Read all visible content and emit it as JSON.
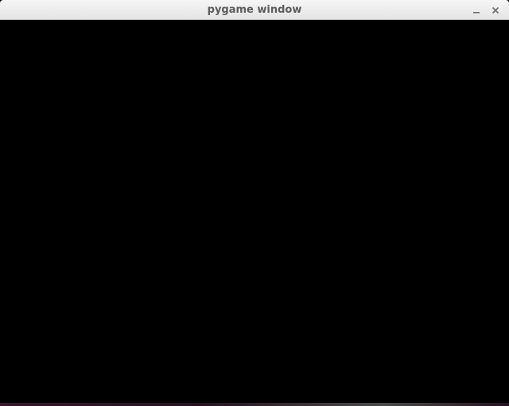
{
  "window": {
    "title": "pygame window",
    "controls": {
      "minimize_icon": "minimize-icon",
      "close_icon": "close-icon"
    },
    "content_background": "#000000"
  }
}
